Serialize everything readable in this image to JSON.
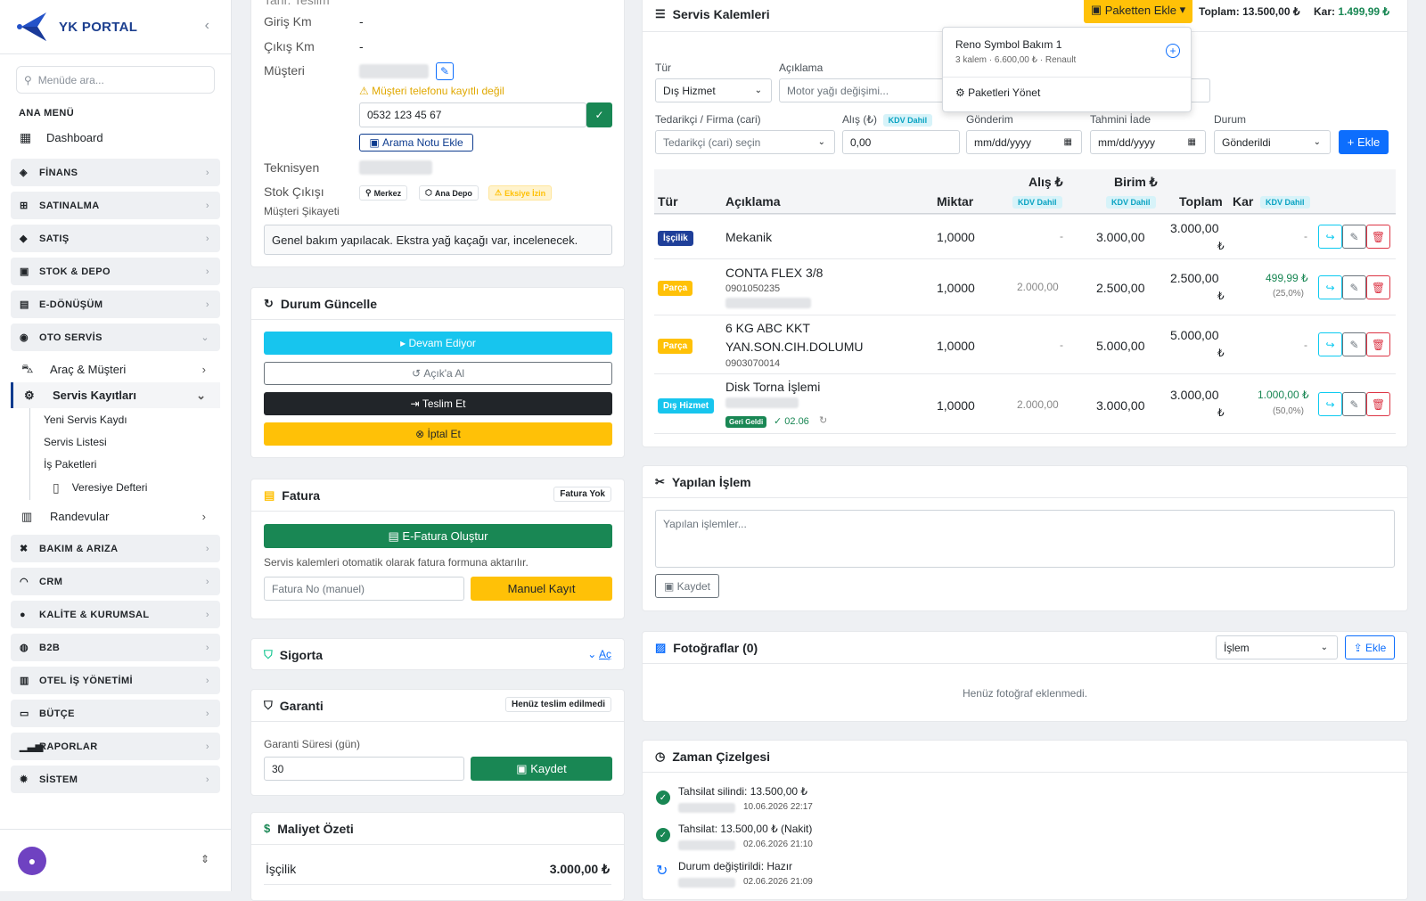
{
  "brand": {
    "title": "YK PORTAL"
  },
  "sidebar": {
    "search_placeholder": "Menüde ara...",
    "section": "ANA MENÜ",
    "dashboard": "Dashboard",
    "groups": [
      "FİNANS",
      "SATINALMA",
      "SATIŞ",
      "STOK & DEPO",
      "E-DÖNÜŞÜM",
      "OTO SERVİS"
    ],
    "oto": {
      "arac": "Araç & Müşteri",
      "servis": "Servis Kayıtları",
      "subs": [
        "Yeni Servis Kaydı",
        "Servis Listesi",
        "İş Paketleri"
      ],
      "veresiye": "Veresiye Defteri",
      "randevu": "Randevular"
    },
    "groups2": [
      "BAKIM & ARIZA",
      "CRM",
      "KALİTE & KURUMSAL",
      "B2B",
      "OTEL İŞ YÖNETİMİ",
      "BÜTÇE",
      "RAPORLAR",
      "SİSTEM"
    ]
  },
  "info": {
    "top_cut": "Tahr. Teslim",
    "giris_lbl": "Giriş Km",
    "giris_val": "-",
    "cikis_lbl": "Çıkış Km",
    "cikis_val": "-",
    "musteri_lbl": "Müşteri",
    "phone_warn": "Müşteri telefonu kayıtlı değil",
    "phone_value": "0532 123 45 67",
    "arama_notu": "Arama Notu Ekle",
    "teknisyen_lbl": "Teknisyen",
    "stok_lbl": "Stok Çıkışı",
    "stok_badges": [
      "Merkez",
      "Ana Depo",
      "Eksiye İzin"
    ],
    "sikayet_lbl": "Müşteri Şikayeti",
    "sikayet_val": "Genel bakım yapılacak. Ekstra yağ kaçağı var, incelenecek."
  },
  "durum": {
    "title": "Durum Güncelle",
    "devam": "Devam Ediyor",
    "acik": "Açık'a Al",
    "teslim": "Teslim Et",
    "iptal": "İptal Et"
  },
  "fatura": {
    "title": "Fatura",
    "badge": "Fatura Yok",
    "efatura": "E-Fatura Oluştur",
    "note": "Servis kalemleri otomatik olarak fatura formuna aktarılır.",
    "no_placeholder": "Fatura No (manuel)",
    "manuel": "Manuel Kayıt"
  },
  "sigorta": {
    "title": "Sigorta",
    "toggle": "Aç"
  },
  "garanti": {
    "title": "Garanti",
    "badge": "Henüz teslim edilmedi",
    "sure_lbl": "Garanti Süresi (gün)",
    "sure_val": "30",
    "kaydet": "Kaydet"
  },
  "maliyet": {
    "title": "Maliyet Özeti",
    "iscilik_lbl": "İşçilik",
    "iscilik_val": "3.000,00 ₺"
  },
  "kalemler": {
    "title": "Servis Kalemleri",
    "paketten": "Paketten Ekle",
    "toplam": "Toplam: 13.500,00 ₺",
    "kar_lbl": "Kar:",
    "kar_val": "1.499,99 ₺",
    "dropdown": {
      "name": "Reno Symbol Bakım 1",
      "meta": "3 kalem · 6.600,00 ₺ · Renault",
      "manage": "Paketleri Yönet"
    },
    "form": {
      "tur_lbl": "Tür",
      "tur_val": "Dış Hizmet",
      "aciklama_lbl": "Açıklama",
      "aciklama_val": "Motor yağı değişimi...",
      "tedarikci_lbl": "Tedarikçi / Firma (cari)",
      "tedarikci_val": "Tedarikçi (cari) seçin",
      "alis_lbl": "Alış (₺)",
      "alis_val": "0,00",
      "kdv": "KDV Dahil",
      "gonderim_lbl": "Gönderim",
      "gonderim_val": "mm/dd/yyyy",
      "iade_lbl": "Tahmini İade",
      "iade_val": "mm/dd/yyyy",
      "durum_lbl": "Durum",
      "durum_val": "Gönderildi",
      "ekle": "Ekle"
    },
    "headers": {
      "tur": "Tür",
      "aciklama": "Açıklama",
      "miktar": "Miktar",
      "alis": "Alış ₺",
      "birim": "Birim ₺",
      "toplam": "Toplam",
      "kar": "Kar",
      "kdv": "KDV Dahil"
    },
    "rows": [
      {
        "tag": "İşçilik",
        "desc": "Mekanik",
        "code": "",
        "miktar": "1,0000",
        "alis": "-",
        "birim": "3.000,00",
        "toplam": "3.000,00",
        "cur": "₺",
        "kar": "-",
        "kar_pct": ""
      },
      {
        "tag": "Parça",
        "desc": "CONTA FLEX 3/8",
        "code": "0901050235",
        "miktar": "1,0000",
        "alis": "2.000,00",
        "birim": "2.500,00",
        "toplam": "2.500,00",
        "cur": "₺",
        "kar": "499,99 ₺",
        "kar_pct": "(25,0%)"
      },
      {
        "tag": "Parça",
        "desc": "6 KG ABC KKT",
        "desc2": "YAN.SON.CIH.DOLUMU",
        "code": "0903070014",
        "miktar": "1,0000",
        "alis": "-",
        "birim": "5.000,00",
        "toplam": "5.000,00",
        "cur": "₺",
        "kar": "-",
        "kar_pct": ""
      },
      {
        "tag": "Dış Hizmet",
        "desc": "Disk Torna İşlemi",
        "code": "",
        "miktar": "1,0000",
        "alis": "2.000,00",
        "birim": "3.000,00",
        "toplam": "3.000,00",
        "cur": "₺",
        "kar": "1.000,00 ₺",
        "kar_pct": "(50,0%)",
        "geri": "Geri Geldi",
        "date": "✓ 02.06"
      }
    ]
  },
  "islem": {
    "title": "Yapılan İşlem",
    "placeholder": "Yapılan işlemler...",
    "kaydet": "Kaydet"
  },
  "foto": {
    "title": "Fotoğraflar (0)",
    "select": "İşlem",
    "ekle": "Ekle",
    "empty": "Henüz fotoğraf eklenmedi."
  },
  "zaman": {
    "title": "Zaman Çizelgesi",
    "items": [
      {
        "text": "Tahsilat silindi: 13.500,00 ₺",
        "date": "10.06.2026 22:17"
      },
      {
        "text": "Tahsilat: 13.500,00 ₺ (Nakit)",
        "date": "02.06.2026 21:10"
      },
      {
        "text": "Durum değiştirildi: Hazır",
        "date": "02.06.2026 21:09"
      }
    ]
  },
  "colors": {
    "primary": "#0d3b8e",
    "info": "#0dcaf0",
    "warning": "#ffc107",
    "success": "#198754",
    "danger": "#dc3545",
    "blue": "#0d6efd"
  }
}
